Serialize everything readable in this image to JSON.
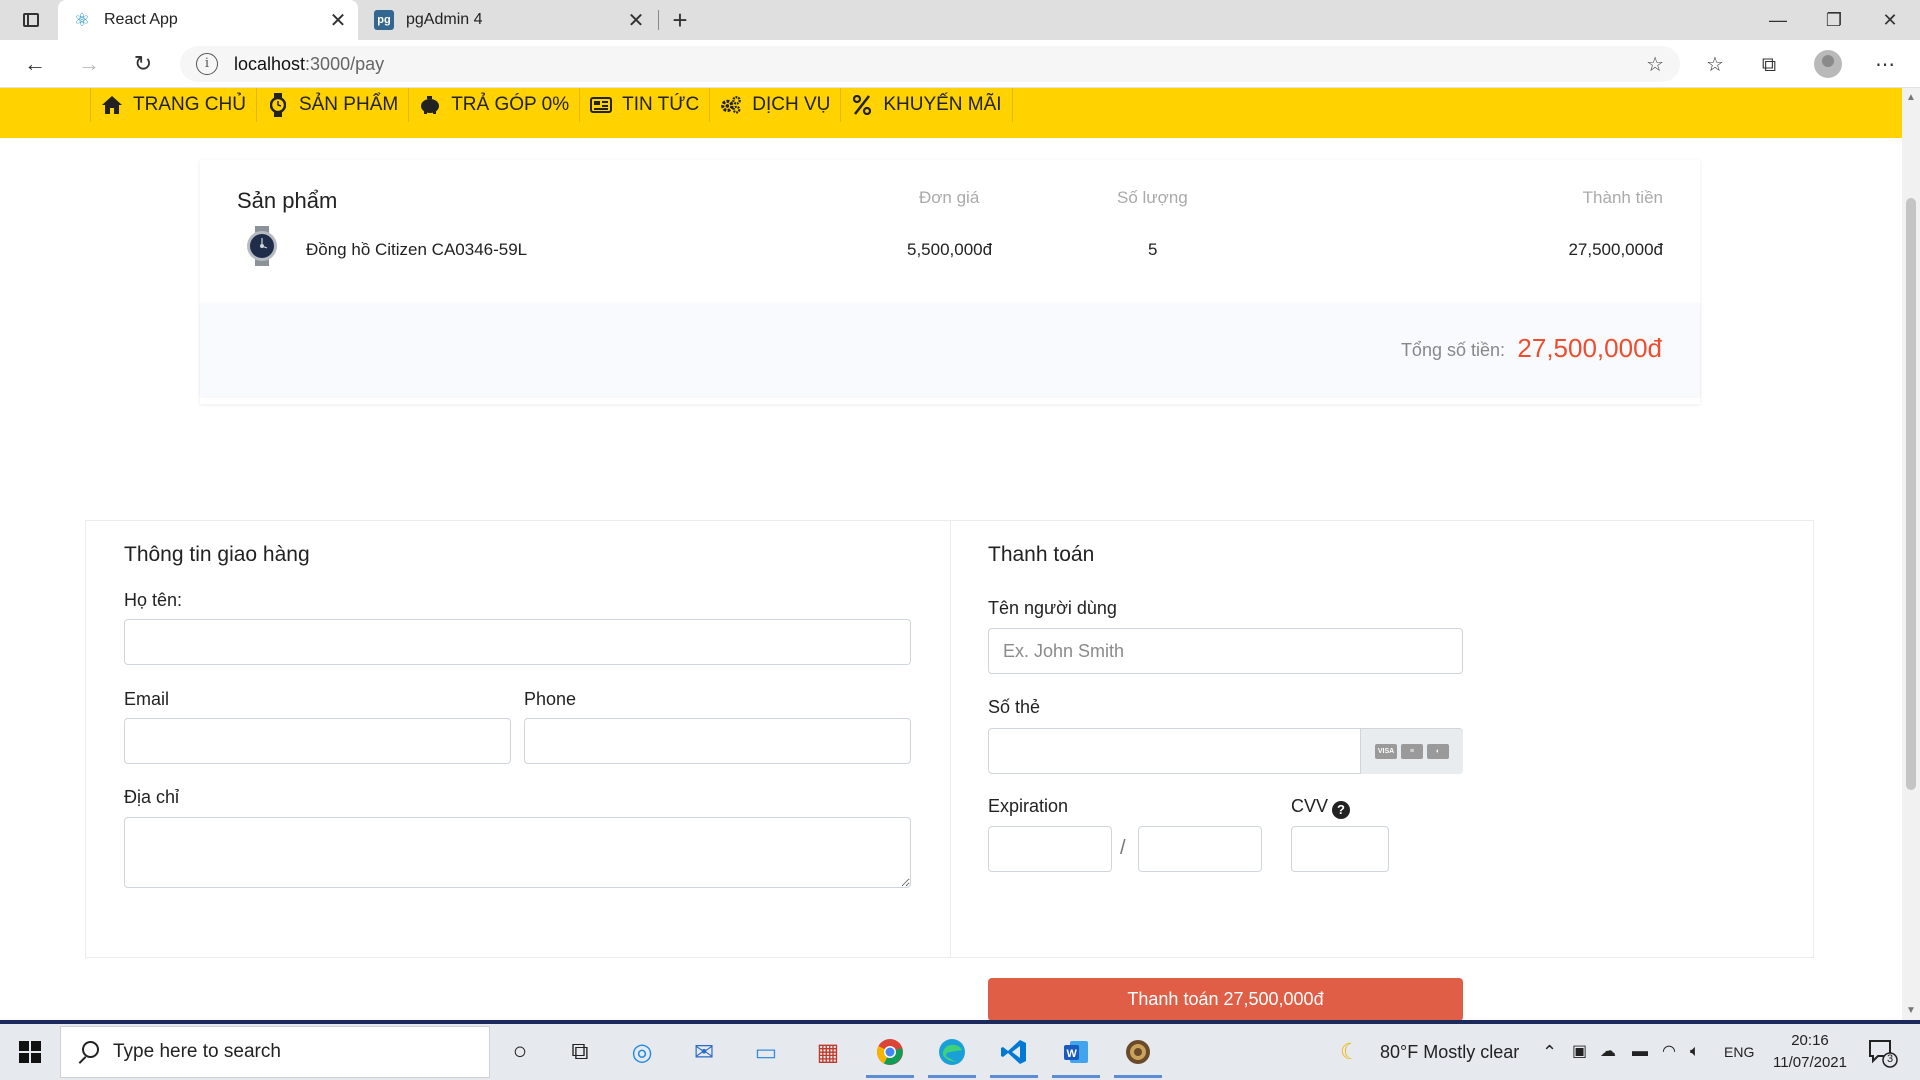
{
  "browser": {
    "tabs": [
      {
        "title": "React App",
        "icon": "react-icon",
        "active": true
      },
      {
        "title": "pgAdmin 4",
        "icon": "pgadmin-icon",
        "active": false
      }
    ],
    "url_host": "localhost",
    "url_path": ":3000/pay"
  },
  "nav": {
    "items": [
      {
        "label": "TRANG CHỦ",
        "icon": "home-icon"
      },
      {
        "label": "SẢN PHẨM",
        "icon": "watch-icon"
      },
      {
        "label": "TRẢ GÓP 0%",
        "icon": "piggy-bank-icon"
      },
      {
        "label": "TIN TỨC",
        "icon": "newspaper-icon"
      },
      {
        "label": "DỊCH VỤ",
        "icon": "gears-icon"
      },
      {
        "label": "KHUYẾN MÃI",
        "icon": "percent-icon"
      }
    ]
  },
  "cart": {
    "headers": {
      "product": "Sản phẩm",
      "unit_price": "Đơn giá",
      "quantity": "Số lượng",
      "subtotal": "Thành tiền"
    },
    "rows": [
      {
        "name": "Đồng hồ Citizen CA0346-59L",
        "unit_price": "5,500,000đ",
        "quantity": "5",
        "subtotal": "27,500,000đ"
      }
    ],
    "total_label": "Tổng số tiền:",
    "total_value": "27,500,000đ",
    "accent_color": "#ee4d2d"
  },
  "shipping": {
    "title": "Thông tin giao hàng",
    "name_label": "Họ tên:",
    "email_label": "Email",
    "phone_label": "Phone",
    "address_label": "Địa chỉ"
  },
  "payment": {
    "title": "Thanh toán",
    "username_label": "Tên người dùng",
    "username_placeholder": "Ex. John Smith",
    "card_label": "Số thẻ",
    "expiration_label": "Expiration",
    "expiration_separator": "/",
    "cvv_label": "CVV",
    "pay_button": "Thanh toán 27,500,000đ",
    "button_color": "#e15e46"
  },
  "taskbar": {
    "search_placeholder": "Type here to search",
    "weather": "80°F  Mostly clear",
    "language": "ENG",
    "time": "20:16",
    "date": "11/07/2021",
    "notifications": "3"
  }
}
